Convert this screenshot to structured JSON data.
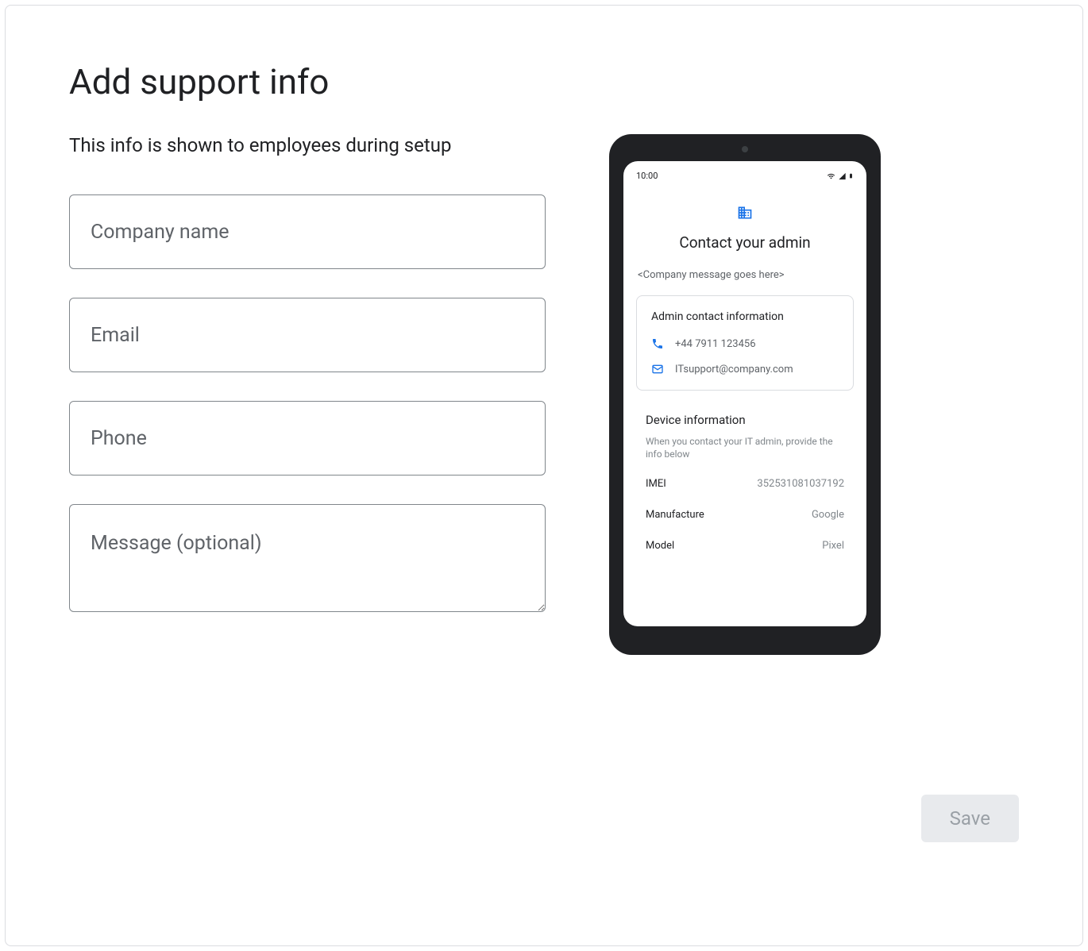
{
  "page": {
    "title": "Add support info",
    "subtitle": "This info is shown to employees during setup"
  },
  "form": {
    "company_name": {
      "placeholder": "Company name",
      "value": ""
    },
    "email": {
      "placeholder": "Email",
      "value": ""
    },
    "phone": {
      "placeholder": "Phone",
      "value": ""
    },
    "message": {
      "placeholder": "Message (optional)",
      "value": ""
    }
  },
  "preview": {
    "status_time": "10:00",
    "title": "Contact your admin",
    "message_placeholder": "<Company message goes here>",
    "admin_card": {
      "title": "Admin contact information",
      "phone": "+44 7911 123456",
      "email": "ITsupport@company.com"
    },
    "device_info": {
      "title": "Device information",
      "subtitle": "When you contact your IT admin, provide the info below",
      "rows": [
        {
          "label": "IMEI",
          "value": "352531081037192"
        },
        {
          "label": "Manufacture",
          "value": "Google"
        },
        {
          "label": "Model",
          "value": "Pixel"
        }
      ]
    }
  },
  "actions": {
    "save_label": "Save"
  }
}
